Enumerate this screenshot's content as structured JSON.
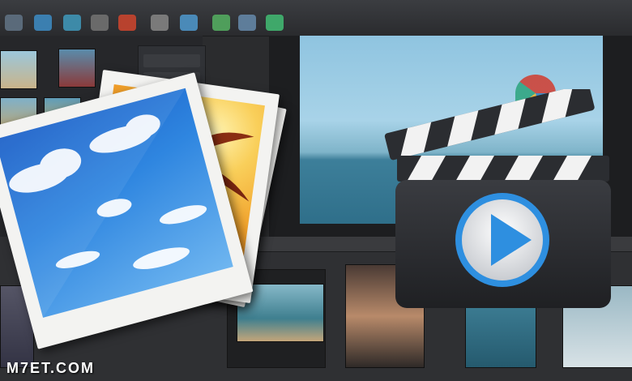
{
  "watermark": {
    "text": "M7ET.COM"
  },
  "toolbar": {
    "buttons": [
      "toolbar-button-1",
      "toolbar-button-2",
      "toolbar-button-3",
      "toolbar-button-4",
      "toolbar-button-5",
      "toolbar-button-6",
      "toolbar-button-7",
      "toolbar-button-8",
      "toolbar-button-9",
      "toolbar-button-10"
    ]
  },
  "icons": {
    "photos": "photo-stack-icon",
    "video": "clapperboard-play-icon"
  },
  "colors": {
    "sky": "#2e7fd6",
    "sunset": "#f3b23a",
    "clapper_dark": "#2b2d31",
    "play_blue": "#2e8fe0",
    "watermark": "#ffffff"
  }
}
